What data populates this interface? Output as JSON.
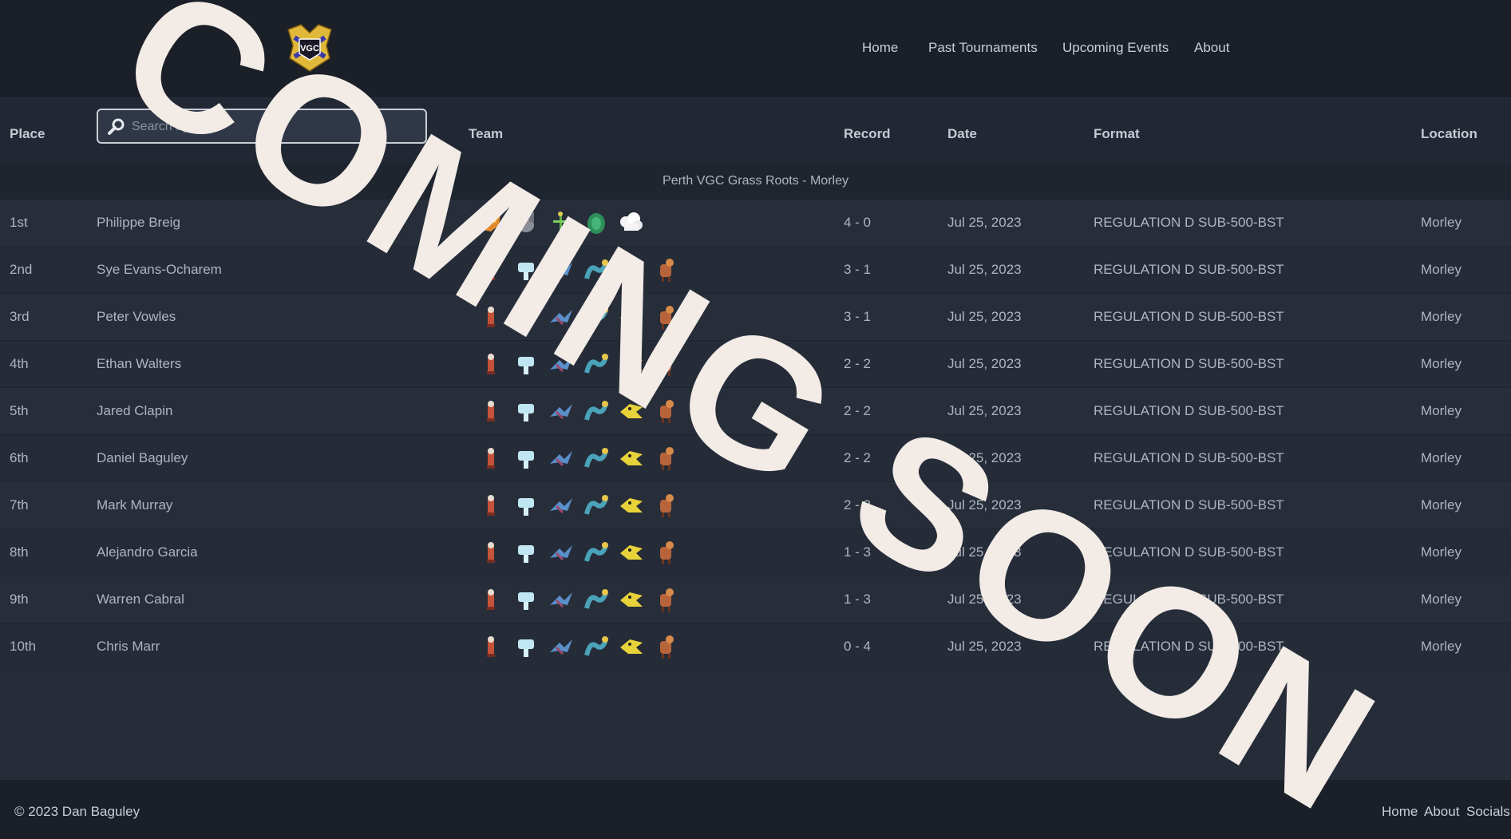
{
  "nav": {
    "home": "Home",
    "past": "Past Tournaments",
    "upcoming": "Upcoming Events",
    "about": "About"
  },
  "logo_text": "VGC",
  "table": {
    "headers": {
      "place": "Place",
      "team": "Team",
      "record": "Record",
      "date": "Date",
      "format": "Format",
      "location": "Location"
    },
    "search_placeholder": "Search by N",
    "group": "Perth VGC Grass Roots - Morley",
    "rows": [
      {
        "place": "1st",
        "name": "Philippe Breig",
        "record": "4 - 0",
        "date": "Jul 25, 2023",
        "format": "REGULATION D SUB-500-BST",
        "location": "Morley",
        "team": [
          "orange-bird-icon",
          "grey-creature-icon",
          "green-stick-icon",
          "green-leaf-icon",
          "white-cloud-icon"
        ]
      },
      {
        "place": "2nd",
        "name": "Sye Evans-Ocharem",
        "record": "3 - 1",
        "date": "Jul 25, 2023",
        "format": "REGULATION D SUB-500-BST",
        "location": "Morley",
        "team": [
          "red-fox-icon",
          "light-blue-icon",
          "blue-wing-icon",
          "teal-serpent-icon",
          "yellow-bird-icon",
          "brown-horse-icon"
        ]
      },
      {
        "place": "3rd",
        "name": "Peter Vowles",
        "record": "3 - 1",
        "date": "Jul 25, 2023",
        "format": "REGULATION D SUB-500-BST",
        "location": "Morley",
        "team": [
          "red-fox-icon",
          "light-blue-icon",
          "blue-wing-icon",
          "teal-serpent-icon",
          "yellow-bird-icon",
          "brown-horse-icon"
        ]
      },
      {
        "place": "4th",
        "name": "Ethan Walters",
        "record": "2 - 2",
        "date": "Jul 25, 2023",
        "format": "REGULATION D SUB-500-BST",
        "location": "Morley",
        "team": [
          "red-fox-icon",
          "light-blue-icon",
          "blue-wing-icon",
          "teal-serpent-icon",
          "yellow-bird-icon",
          "brown-horse-icon"
        ]
      },
      {
        "place": "5th",
        "name": "Jared Clapin",
        "record": "2 - 2",
        "date": "Jul 25, 2023",
        "format": "REGULATION D SUB-500-BST",
        "location": "Morley",
        "team": [
          "red-fox-icon",
          "light-blue-icon",
          "blue-wing-icon",
          "teal-serpent-icon",
          "yellow-bird-icon",
          "brown-horse-icon"
        ]
      },
      {
        "place": "6th",
        "name": "Daniel Baguley",
        "record": "2 - 2",
        "date": "Jul 25, 2023",
        "format": "REGULATION D SUB-500-BST",
        "location": "Morley",
        "team": [
          "red-fox-icon",
          "light-blue-icon",
          "blue-wing-icon",
          "teal-serpent-icon",
          "yellow-bird-icon",
          "brown-horse-icon"
        ]
      },
      {
        "place": "7th",
        "name": "Mark Murray",
        "record": "2 - 2",
        "date": "Jul 25, 2023",
        "format": "REGULATION D SUB-500-BST",
        "location": "Morley",
        "team": [
          "red-fox-icon",
          "light-blue-icon",
          "blue-wing-icon",
          "teal-serpent-icon",
          "yellow-bird-icon",
          "brown-horse-icon"
        ]
      },
      {
        "place": "8th",
        "name": "Alejandro Garcia",
        "record": "1 - 3",
        "date": "Jul 25, 2023",
        "format": "REGULATION D SUB-500-BST",
        "location": "Morley",
        "team": [
          "red-fox-icon",
          "light-blue-icon",
          "blue-wing-icon",
          "teal-serpent-icon",
          "yellow-bird-icon",
          "brown-horse-icon"
        ]
      },
      {
        "place": "9th",
        "name": "Warren Cabral",
        "record": "1 - 3",
        "date": "Jul 25, 2023",
        "format": "REGULATION D SUB-500-BST",
        "location": "Morley",
        "team": [
          "red-fox-icon",
          "light-blue-icon",
          "blue-wing-icon",
          "teal-serpent-icon",
          "yellow-bird-icon",
          "brown-horse-icon"
        ]
      },
      {
        "place": "10th",
        "name": "Chris Marr",
        "record": "0 - 4",
        "date": "Jul 25, 2023",
        "format": "REGULATION D SUB-500-BST",
        "location": "Morley",
        "team": [
          "red-fox-icon",
          "light-blue-icon",
          "blue-wing-icon",
          "teal-serpent-icon",
          "yellow-bird-icon",
          "brown-horse-icon"
        ]
      }
    ]
  },
  "footer": {
    "copyright": "© 2023 Dan Baguley",
    "links": {
      "home": "Home",
      "about": "About",
      "socials": "Socials"
    }
  },
  "overlay_text": "COMING SOON",
  "colors": {
    "header_bg": "#1b1f27",
    "body_bg": "#262d39",
    "overlay_text": "#f2ebe6"
  }
}
